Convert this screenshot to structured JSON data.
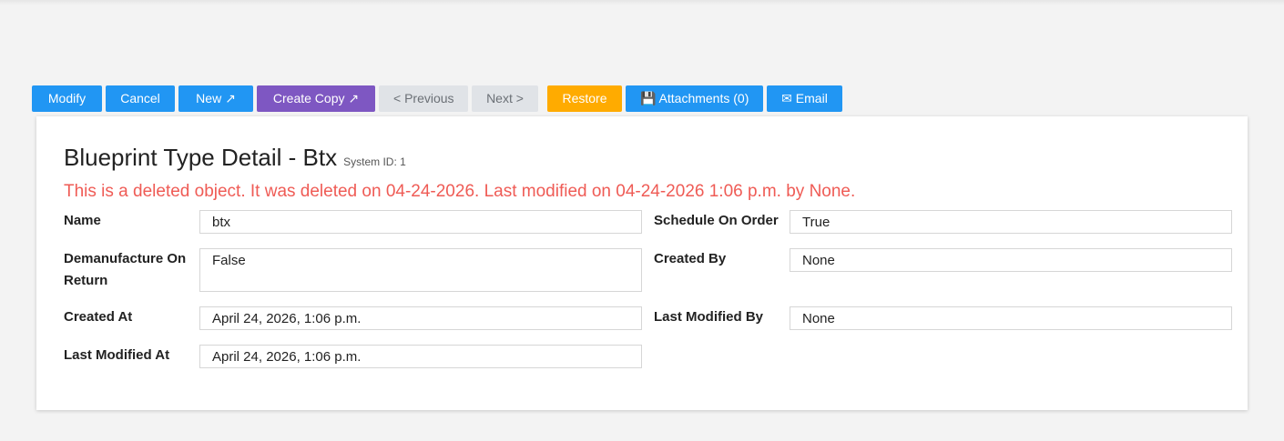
{
  "toolbar": {
    "modify": "Modify",
    "cancel": "Cancel",
    "new": "New ↗",
    "create_copy": "Create Copy ↗",
    "previous": "< Previous",
    "next": "Next >",
    "restore": "Restore",
    "attachments": "💾 Attachments (0)",
    "email": "✉ Email"
  },
  "detail": {
    "title": "Blueprint Type Detail - Btx",
    "system_id": "System ID: 1",
    "deleted_message": "This is a deleted object. It was deleted on 04-24-2026. Last modified on 04-24-2026 1:06 p.m. by None."
  },
  "fields": {
    "name": {
      "label": "Name",
      "value": "btx"
    },
    "schedule_on_order": {
      "label": "Schedule On Order",
      "value": "True"
    },
    "demanufacture_on_return": {
      "label": "Demanufacture On Return",
      "value": "False"
    },
    "created_by": {
      "label": "Created By",
      "value": "None"
    },
    "created_at": {
      "label": "Created At",
      "value": "April 24, 2026, 1:06 p.m."
    },
    "last_modified_by": {
      "label": "Last Modified By",
      "value": "None"
    },
    "last_modified_at": {
      "label": "Last Modified At",
      "value": "April 24, 2026, 1:06 p.m."
    }
  }
}
